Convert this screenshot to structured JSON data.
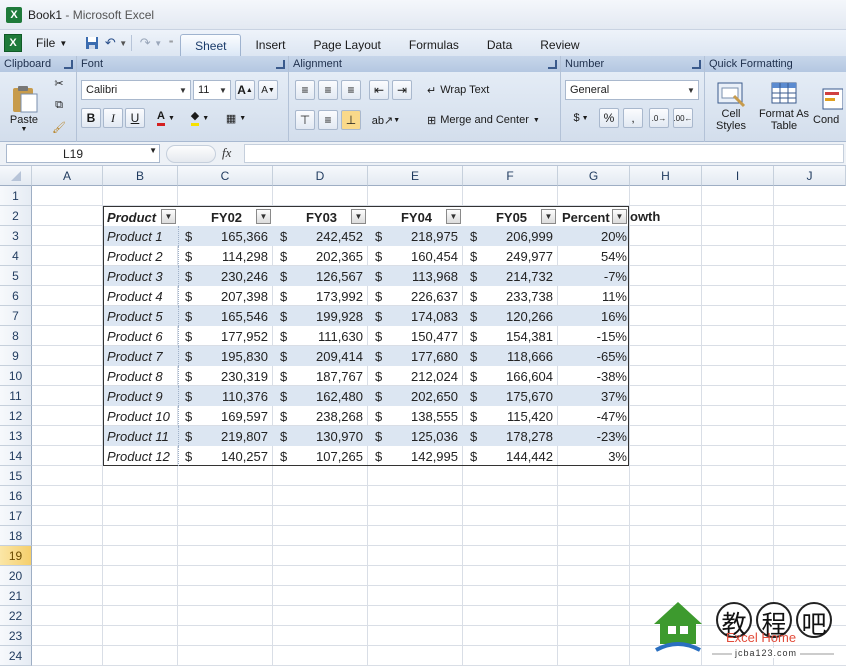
{
  "window": {
    "title": "Book1",
    "app": " - Microsoft Excel"
  },
  "menu": {
    "file": "File",
    "tabs": [
      "Sheet",
      "Insert",
      "Page Layout",
      "Formulas",
      "Data",
      "Review"
    ],
    "active_tab": "Sheet"
  },
  "ribbon": {
    "clipboard": {
      "title": "Clipboard",
      "paste": "Paste"
    },
    "font": {
      "title": "Font",
      "family": "Calibri",
      "size": "11"
    },
    "alignment": {
      "title": "Alignment",
      "wrap": "Wrap Text",
      "merge": "Merge and Center"
    },
    "number": {
      "title": "Number",
      "format": "General",
      "currency": "$",
      "percent": "%",
      "comma": ","
    },
    "quick": {
      "title": "Quick Formatting",
      "cell_styles": "Cell Styles",
      "format_table": "Format As Table",
      "cond": "Cond"
    }
  },
  "formula_bar": {
    "name_box": "L19",
    "fx": "fx"
  },
  "columns": [
    "A",
    "B",
    "C",
    "D",
    "E",
    "F",
    "G",
    "H",
    "I",
    "J"
  ],
  "rows": [
    "1",
    "2",
    "3",
    "4",
    "5",
    "6",
    "7",
    "8",
    "9",
    "10",
    "11",
    "12",
    "13",
    "14",
    "15",
    "16",
    "17",
    "18",
    "19",
    "20",
    "21",
    "22",
    "23",
    "24"
  ],
  "selected_row": "19",
  "table": {
    "headers": [
      "Product",
      "FY02",
      "FY03",
      "FY04",
      "FY05",
      "Percent"
    ],
    "header_overflow": "owth",
    "currency": "$",
    "rows": [
      [
        "Product 1",
        "165,366",
        "242,452",
        "218,975",
        "206,999",
        "20%"
      ],
      [
        "Product 2",
        "114,298",
        "202,365",
        "160,454",
        "249,977",
        "54%"
      ],
      [
        "Product 3",
        "230,246",
        "126,567",
        "113,968",
        "214,732",
        "-7%"
      ],
      [
        "Product 4",
        "207,398",
        "173,992",
        "226,637",
        "233,738",
        "11%"
      ],
      [
        "Product 5",
        "165,546",
        "199,928",
        "174,083",
        "120,266",
        "16%"
      ],
      [
        "Product 6",
        "177,952",
        "111,630",
        "150,477",
        "154,381",
        "-15%"
      ],
      [
        "Product 7",
        "195,830",
        "209,414",
        "177,680",
        "118,666",
        "-65%"
      ],
      [
        "Product 8",
        "230,319",
        "187,767",
        "212,024",
        "166,604",
        "-38%"
      ],
      [
        "Product 9",
        "110,376",
        "162,480",
        "202,650",
        "175,670",
        "37%"
      ],
      [
        "Product 10",
        "169,597",
        "238,268",
        "138,555",
        "115,420",
        "-47%"
      ],
      [
        "Product 11",
        "219,807",
        "130,970",
        "125,036",
        "178,278",
        "-23%"
      ],
      [
        "Product 12",
        "140,257",
        "107,265",
        "142,995",
        "144,442",
        "3%"
      ]
    ]
  },
  "watermark": {
    "chars": "教程吧",
    "line1": "Excel Home",
    "line2": "jcba123.com"
  },
  "colors": {
    "band": "#dce6f2",
    "selected_row": "#f5cf6c",
    "excel_green": "#1e7a3a"
  }
}
